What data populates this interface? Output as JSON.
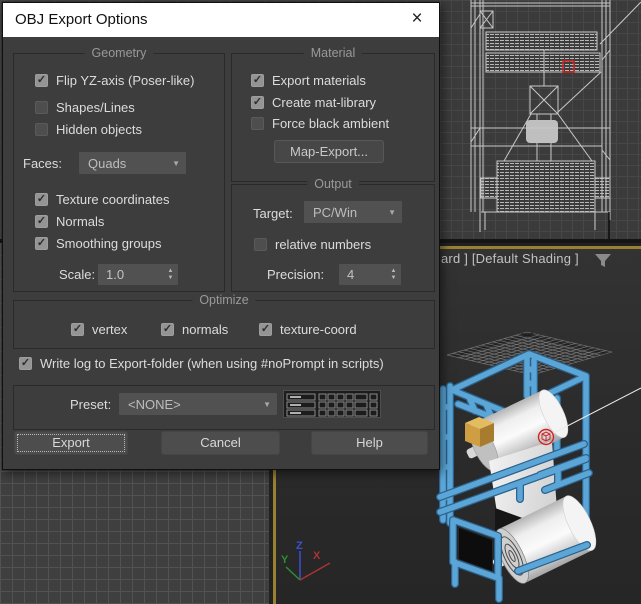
{
  "dialog": {
    "title": "OBJ Export Options",
    "geometry": {
      "title": "Geometry",
      "flip": "Flip YZ-axis (Poser-like)",
      "shapes": "Shapes/Lines",
      "hidden": "Hidden objects",
      "faces_label": "Faces:",
      "faces_value": "Quads",
      "texcoords": "Texture coordinates",
      "normals": "Normals",
      "smoothing": "Smoothing groups",
      "scale_label": "Scale:",
      "scale_value": "1.0"
    },
    "material": {
      "title": "Material",
      "export_materials": "Export materials",
      "create_matlib": "Create mat-library",
      "force_black": "Force black ambient",
      "map_export": "Map-Export..."
    },
    "output": {
      "title": "Output",
      "target_label": "Target:",
      "target_value": "PC/Win",
      "relative": "relative numbers",
      "precision_label": "Precision:",
      "precision_value": "4"
    },
    "optimize": {
      "title": "Optimize",
      "vertex": "vertex",
      "normals": "normals",
      "texcoord": "texture-coord"
    },
    "write_log": "Write log to Export-folder (when using #noPrompt in scripts)",
    "preset": {
      "label": "Preset:",
      "value": "<NONE>"
    },
    "buttons": {
      "export": "Export",
      "cancel": "Cancel",
      "help": "Help"
    }
  },
  "states": {
    "flip": true,
    "shapes": false,
    "hidden": false,
    "texcoords": true,
    "normals": true,
    "smoothing": true,
    "export_materials": true,
    "create_matlib": true,
    "force_black": false,
    "relative": false,
    "opt_vertex": true,
    "opt_normals": true,
    "opt_texcoord": true,
    "write_log": true
  },
  "icons": {
    "close": "×",
    "check": "✓",
    "dropdown_arrow": "▼",
    "spinner_up": "▲",
    "spinner_down": "▼"
  },
  "viewport": {
    "label": "ard ] [Default Shading ]",
    "axis": {
      "x": "X",
      "y": "Y",
      "z": "Z"
    },
    "colors": {
      "active_border": "#9a8132",
      "axis_x": "#aa3333",
      "axis_y": "#2f8f2f",
      "axis_z": "#3b4fd8",
      "frame_blue": "#5ba6d6",
      "selection_red": "#d42222"
    }
  }
}
